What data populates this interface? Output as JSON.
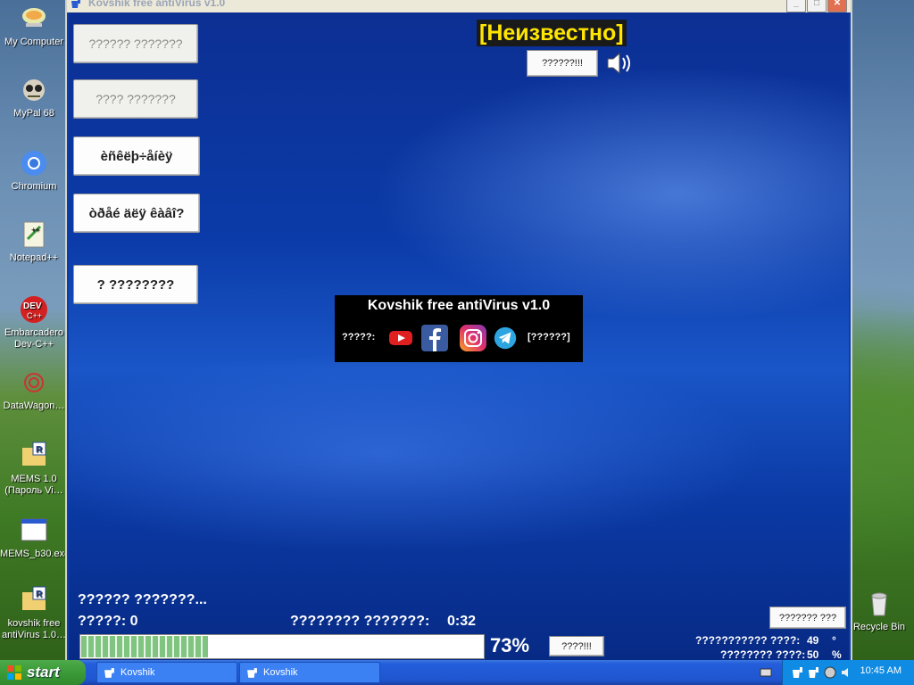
{
  "desktop": {
    "icons": [
      {
        "label": "My Computer",
        "icon": "my-computer-icon"
      },
      {
        "label": "MyPal 68",
        "icon": "mypal-icon"
      },
      {
        "label": "Chromium",
        "icon": "chromium-icon"
      },
      {
        "label": "Notepad++",
        "icon": "notepad-plus-plus-icon"
      },
      {
        "label": "Embarcadero Dev-C++",
        "icon": "devcpp-icon"
      },
      {
        "label": "DataWagon…",
        "icon": "datawagon-icon"
      },
      {
        "label": "MEMS 1.0 (Пароль Vi…",
        "icon": "folder-icon"
      },
      {
        "label": "MEMS_b30.exe",
        "icon": "exe-window-icon"
      },
      {
        "label": "kovshik free antiVirus 1.0…",
        "icon": "folder-icon"
      },
      {
        "label": "Recycle Bin",
        "icon": "recycle-bin-icon"
      }
    ]
  },
  "window": {
    "title": "Kovshik free antiVirus v1.0",
    "controls": {
      "minimize": "_",
      "maximize": "□",
      "close": "✕"
    }
  },
  "side_buttons": [
    {
      "label": "?????? ???????",
      "enabled": false
    },
    {
      "label": "???? ???????",
      "enabled": false
    },
    {
      "label": "èñêëþ÷åíèÿ",
      "enabled": true
    },
    {
      "label": "òðåé äëÿ êàâî?",
      "enabled": true
    },
    {
      "label": "? ????????",
      "enabled": true
    }
  ],
  "status": {
    "title": "[Неизвестно]",
    "action_button": "??????!!!",
    "sound_icon": "speaker-icon"
  },
  "about": {
    "name": "Kovshik free antiVirus v1.0",
    "social_label": "?????:",
    "right_label": "[??????]",
    "icons": [
      "youtube-icon",
      "facebook-icon",
      "instagram-icon",
      "telegram-icon"
    ]
  },
  "scan": {
    "status_text": "?????? ???????...",
    "found_label": "?????: 0",
    "time_label": "???????? ???????:",
    "time_value": "0:32",
    "progress_percent": 73,
    "progress_text": "73%",
    "stop_button": "????!!!"
  },
  "stats": {
    "right_button": "??????? ???",
    "line1_label": "??????????? ????:",
    "line1_value": "49",
    "line1_unit": "°",
    "line2_label": "???????? ????:",
    "line2_value": "50",
    "line2_unit": "%"
  },
  "taskbar": {
    "start_label": "start",
    "tasks": [
      "Kovshik",
      "Kovshik"
    ],
    "clock": "10:45 AM"
  }
}
